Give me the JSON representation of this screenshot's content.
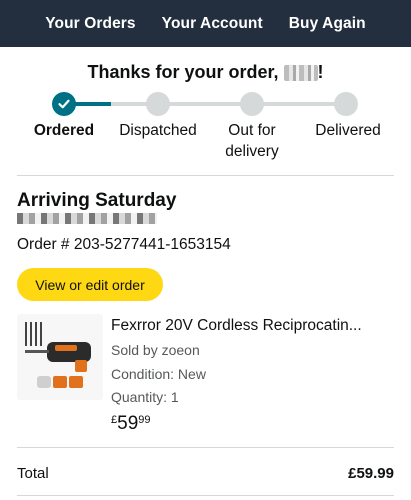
{
  "nav": {
    "items": [
      {
        "label": "Your Orders"
      },
      {
        "label": "Your Account"
      },
      {
        "label": "Buy Again"
      }
    ]
  },
  "confirmation": {
    "heading": "Thanks for your order,",
    "punctuation": "!"
  },
  "progress": {
    "steps": [
      {
        "label": "Ordered",
        "done": true
      },
      {
        "label": "Dispatched",
        "done": false
      },
      {
        "label": "Out for delivery",
        "done": false
      },
      {
        "label": "Delivered",
        "done": false
      }
    ]
  },
  "order": {
    "arriving": "Arriving Saturday",
    "order_number": "Order # 203-5277441-1653154",
    "view_button": "View or edit order"
  },
  "product": {
    "title": "Fexrror 20V Cordless Reciprocatin...",
    "sold_by": "Sold by zoeon",
    "condition": "Condition: New",
    "quantity": "Quantity: 1",
    "price_symbol": "£",
    "price_whole": "59",
    "price_fraction": "99"
  },
  "summary": {
    "total_label": "Total",
    "total_value": "£59.99"
  },
  "colors": {
    "nav_bg": "#232f3e",
    "progress_active": "#007185",
    "progress_inactive": "#d5d9d9",
    "button_yellow": "#ffd814"
  }
}
